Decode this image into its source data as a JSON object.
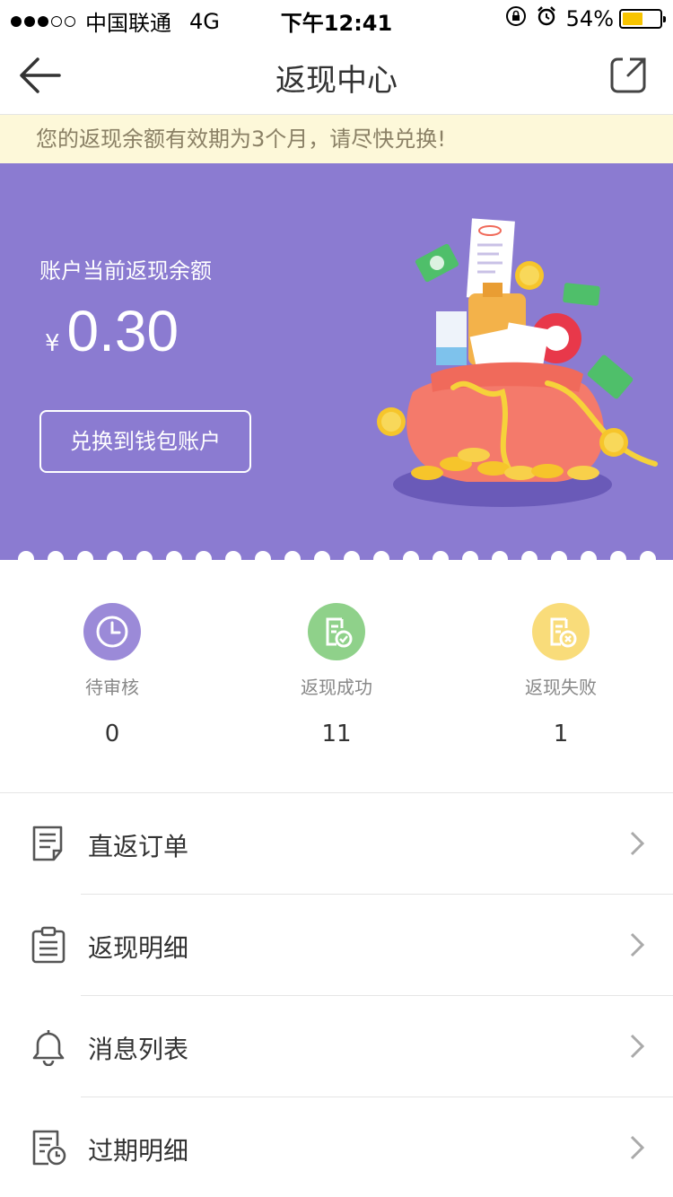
{
  "status_bar": {
    "carrier": "中国联通",
    "network": "4G",
    "time": "下午12:41",
    "battery": "54%",
    "battery_level": 0.54
  },
  "nav": {
    "title": "返现中心",
    "back_icon": "back-arrow-icon",
    "share_icon": "share-icon"
  },
  "notice": {
    "text": "您的返现余额有效期为3个月，请尽快兑换!"
  },
  "banner": {
    "label": "账户当前返现余额",
    "currency": "¥",
    "amount": "0.30",
    "exchange_button": "兑换到钱包账户"
  },
  "stats": [
    {
      "label": "待审核",
      "count": "0",
      "icon": "clock-icon",
      "color": "#9b8ad8"
    },
    {
      "label": "返现成功",
      "count": "11",
      "icon": "document-check-icon",
      "color": "#8fd18a"
    },
    {
      "label": "返现失败",
      "count": "1",
      "icon": "document-x-icon",
      "color": "#f9dc7a"
    }
  ],
  "menu": [
    {
      "label": "直返订单",
      "icon": "order-list-icon"
    },
    {
      "label": "返现明细",
      "icon": "clipboard-icon"
    },
    {
      "label": "消息列表",
      "icon": "bell-icon"
    },
    {
      "label": "过期明细",
      "icon": "document-clock-icon"
    }
  ],
  "colors": {
    "banner": "#8b7bd1",
    "notice_bg": "#fdf8d9",
    "notice_text": "#8a8065"
  }
}
